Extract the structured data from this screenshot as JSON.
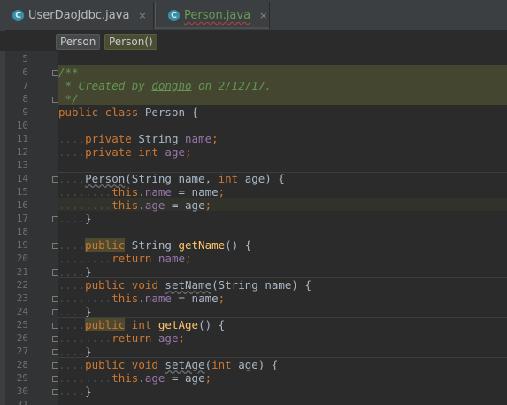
{
  "tabs": [
    {
      "label": "UserDaoJdbc.java",
      "icon": "C",
      "close": "×"
    },
    {
      "label": "Person.java",
      "icon": "C",
      "close": "×"
    }
  ],
  "breadcrumb": [
    "Person",
    "Person()"
  ],
  "colors": {
    "background": "#2b2b2b",
    "keyword": "#cc7832",
    "field": "#9876aa",
    "method": "#ffc66d",
    "comment": "#629755",
    "text": "#a9b7c6"
  },
  "lines": [
    {
      "n": "5"
    },
    {
      "n": "6"
    },
    {
      "n": "7"
    },
    {
      "n": "8"
    },
    {
      "n": "9"
    },
    {
      "n": "10"
    },
    {
      "n": "11"
    },
    {
      "n": "12"
    },
    {
      "n": "13"
    },
    {
      "n": "14"
    },
    {
      "n": "15"
    },
    {
      "n": "16"
    },
    {
      "n": "17"
    },
    {
      "n": "18"
    },
    {
      "n": "19"
    },
    {
      "n": "20"
    },
    {
      "n": "21"
    },
    {
      "n": "22"
    },
    {
      "n": "23"
    },
    {
      "n": "24"
    },
    {
      "n": "25"
    },
    {
      "n": "26"
    },
    {
      "n": "27"
    },
    {
      "n": "28"
    },
    {
      "n": "29"
    },
    {
      "n": "30"
    },
    {
      "n": "31"
    }
  ],
  "code": {
    "l6": "/**",
    "l7a": " * Created by ",
    "l7b": "dongho",
    "l7c": " on 2/12/17.",
    "l8": " */",
    "l9a": "public class ",
    "l9b": "Person {",
    "l11a": "private ",
    "l11b": "String ",
    "l11c": "name",
    "l11d": ";",
    "l12a": "private int ",
    "l12b": "age",
    "l12c": ";",
    "l14a": "Person",
    "l14b": "(String name, ",
    "l14c": "int ",
    "l14d": "age) {",
    "l15a": "this",
    "l15b": ".",
    "l15c": "name",
    "l15d": " = name",
    "l15e": ";",
    "l16a": "this",
    "l16b": ".",
    "l16c": "age",
    "l16d": " = age",
    "l16e": ";",
    "close": "}",
    "l19a": "public",
    "l19b": " String ",
    "l19c": "getName",
    "l19d": "() {",
    "l20a": "return ",
    "l20b": "name",
    "l20c": ";",
    "l22a": "public void ",
    "l22b": "setName",
    "l22c": "(String name) {",
    "l23a": "this",
    "l23b": ".",
    "l23c": "name",
    "l23d": " = name",
    "l23e": ";",
    "l25a": "public",
    "l25b": " int ",
    "l25c": "getAge",
    "l25d": "() {",
    "l26a": "return ",
    "l26b": "age",
    "l26c": ";",
    "l28a": "public void ",
    "l28b": "setAge",
    "l28c": "(",
    "l28d": "int ",
    "l28e": "age) {",
    "l29a": "this",
    "l29b": ".",
    "l29c": "age",
    "l29d": " = age",
    "l29e": ";",
    "dots4": "....",
    "dots8": "........"
  }
}
